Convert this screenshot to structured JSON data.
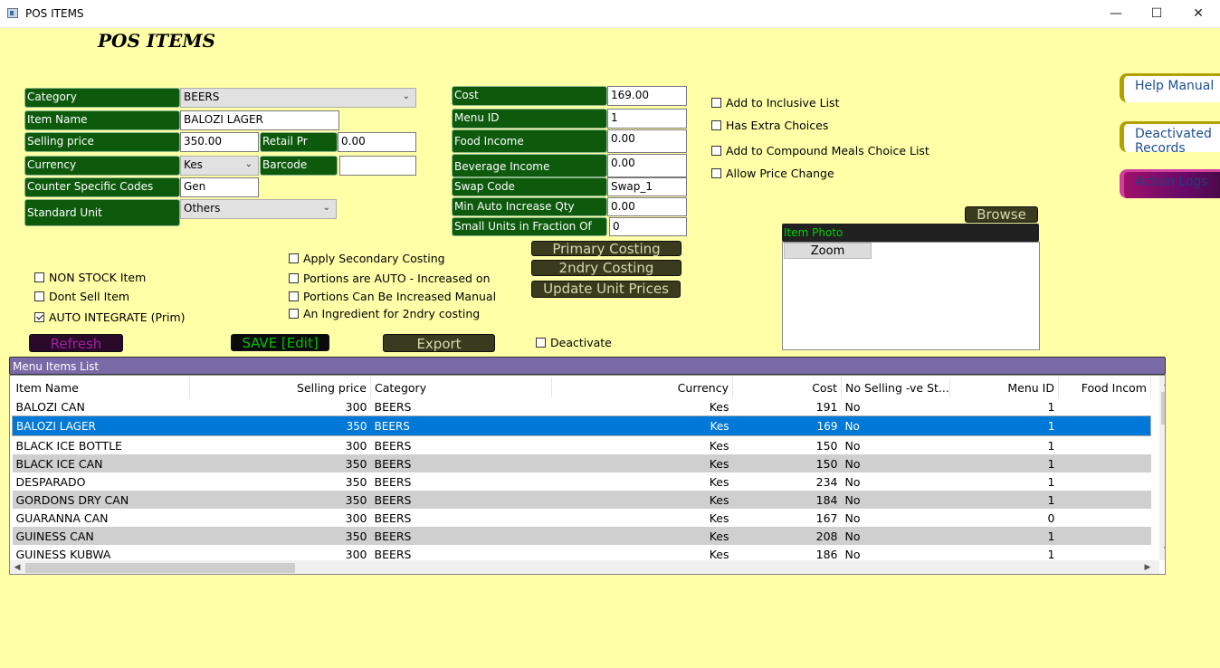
{
  "window": {
    "title": "POS ITEMS",
    "minimize": "—",
    "maximize": "☐",
    "close": "✕"
  },
  "page_title": "POS ITEMS",
  "form": {
    "category_label": "Category",
    "category_value": "BEERS",
    "item_name_label": "Item Name",
    "item_name_value": "BALOZI LAGER",
    "selling_price_label": "Selling price",
    "selling_price_value": "350.00",
    "retail_pr_label": "Retail Pr",
    "retail_pr_value": "0.00",
    "currency_label": "Currency",
    "currency_value": "Kes",
    "barcode_label": "Barcode",
    "barcode_value": "",
    "counter_codes_label": "Counter Specific Codes",
    "counter_codes_value": "Gen",
    "standard_unit_label": "Standard Unit",
    "standard_unit_value": "Others",
    "cost_label": "Cost",
    "cost_value": "169.00",
    "menu_id_label": "Menu ID",
    "menu_id_value": "1",
    "food_income_label": "Food Income",
    "food_income_value": "0.00",
    "beverage_income_label": "Beverage Income",
    "beverage_income_value": "0.00",
    "swap_code_label": "Swap Code",
    "swap_code_value": "Swap_1",
    "min_auto_label": "Min Auto Increase Qty",
    "min_auto_value": "0.00",
    "small_units_label": "Small Units in Fraction Of",
    "small_units_value": "0"
  },
  "checks": {
    "add_inclusive": "Add to Inclusive List",
    "has_extra": "Has Extra Choices",
    "add_compound": "Add to Compound Meals Choice List",
    "allow_price": "Allow Price Change",
    "apply_secondary": "Apply Secondary Costing",
    "portions_auto": "Portions are AUTO - Increased on Or",
    "portions_manual": "Portions Can Be Increased Manual",
    "ingredient": "An Ingredient for 2ndry costing",
    "non_stock": "NON STOCK Item",
    "dont_sell": "Dont Sell Item",
    "auto_integrate": "AUTO INTEGRATE (Prim)",
    "deactivate": "Deactivate"
  },
  "buttons": {
    "help_manual": "Help Manual",
    "deactivated_records": "Deactivated Records",
    "action_logs": "Action Logs",
    "browse": "Browse",
    "primary_costing": "Primary Costing",
    "secondary_costing": "2ndry Costing",
    "update_unit_prices": "Update Unit Prices",
    "refresh": "Refresh",
    "save": "SAVE [Edit]",
    "export": "Export",
    "zoom": "Zoom"
  },
  "photo": {
    "header": "Item Photo"
  },
  "list": {
    "header": "Menu Items List",
    "columns": [
      "Item Name",
      "Selling price",
      "Category",
      "Currency",
      "Cost",
      "No Selling -ve St...",
      "Menu ID",
      "Food Incom"
    ],
    "rows": [
      [
        "BALOZI CAN",
        "300",
        "BEERS",
        "Kes",
        "191",
        "No",
        "1",
        ""
      ],
      [
        "BALOZI LAGER",
        "350",
        "BEERS",
        "Kes",
        "169",
        "No",
        "1",
        ""
      ],
      [
        "BLACK ICE BOTTLE",
        "300",
        "BEERS",
        "Kes",
        "150",
        "No",
        "1",
        ""
      ],
      [
        "BLACK ICE CAN",
        "350",
        "BEERS",
        "Kes",
        "150",
        "No",
        "1",
        ""
      ],
      [
        "DESPARADO",
        "350",
        "BEERS",
        "Kes",
        "234",
        "No",
        "1",
        ""
      ],
      [
        "GORDONS DRY  CAN",
        "350",
        "BEERS",
        "Kes",
        "184",
        "No",
        "1",
        ""
      ],
      [
        "GUARANNA CAN",
        "300",
        "BEERS",
        "Kes",
        "167",
        "No",
        "0",
        ""
      ],
      [
        "GUINESS CAN",
        "350",
        "BEERS",
        "Kes",
        "208",
        "No",
        "1",
        ""
      ],
      [
        "GUINESS KUBWA",
        "300",
        "BEERS",
        "Kes",
        "186",
        "No",
        "1",
        ""
      ]
    ],
    "selected_index": 1
  }
}
